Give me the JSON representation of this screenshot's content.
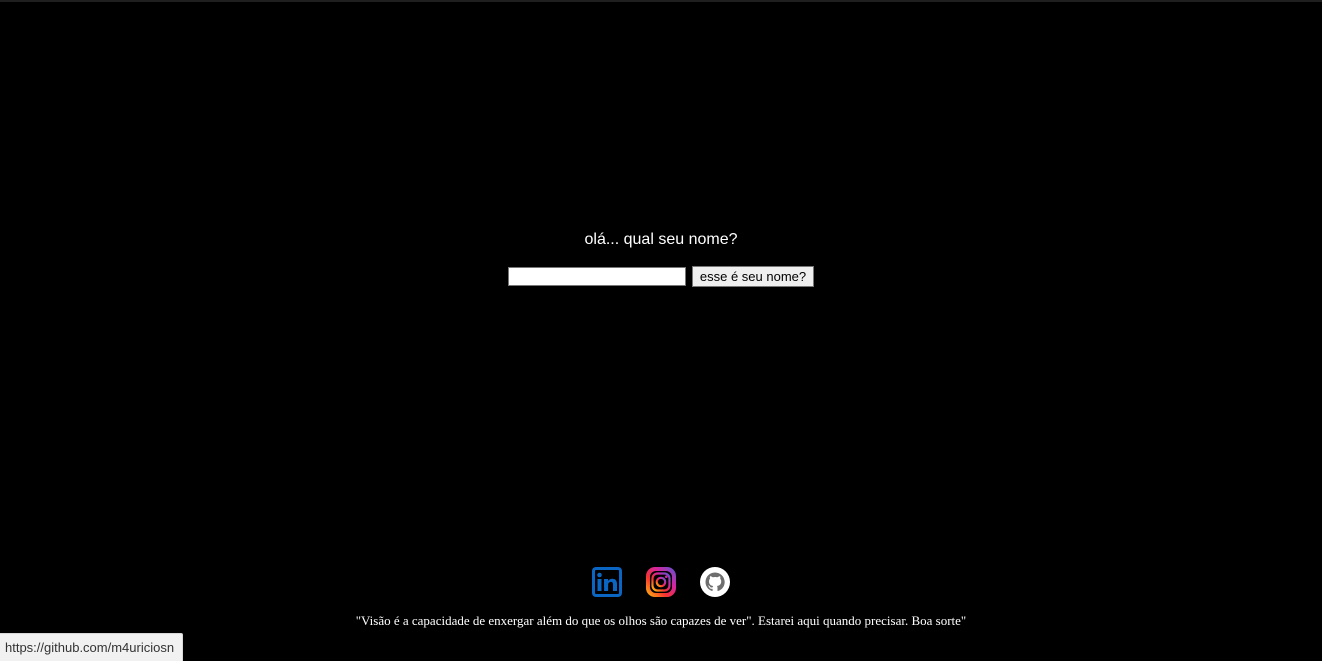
{
  "greeting": {
    "question": "olá... qual seu nome?",
    "name_input_value": "",
    "name_input_placeholder": "",
    "submit_label": "esse é seu nome?"
  },
  "social": {
    "links": [
      {
        "icon": "linkedin-icon",
        "color": "#0a66c2"
      },
      {
        "icon": "instagram-icon",
        "color": "#d6249f"
      },
      {
        "icon": "github-icon",
        "color": "#ffffff"
      }
    ]
  },
  "footer": {
    "quote": "\"Visão é a capacidade de enxergar além do que os olhos são capazes de ver\". Estarei aqui quando precisar. Boa sorte\""
  },
  "browser": {
    "status_url": "https://github.com/m4uriciosn"
  },
  "colors": {
    "background": "#000000",
    "text": "#ffffff"
  }
}
